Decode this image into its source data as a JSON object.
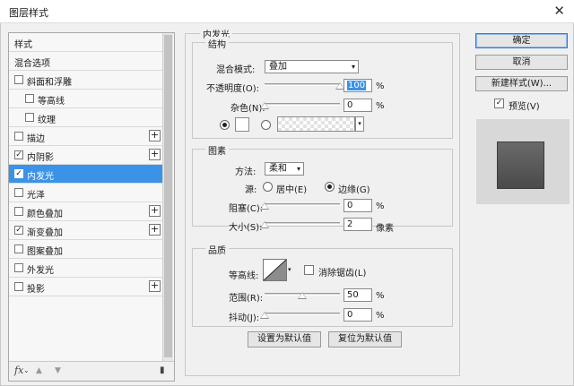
{
  "window": {
    "title": "图层样式"
  },
  "style_list": {
    "header": "样式",
    "items": [
      {
        "label": "混合选项",
        "has_checkbox": false,
        "checked": false,
        "has_plus": false,
        "indent": 0,
        "selected": false
      },
      {
        "label": "斜面和浮雕",
        "has_checkbox": true,
        "checked": false,
        "has_plus": false,
        "indent": 0,
        "selected": false
      },
      {
        "label": "等高线",
        "has_checkbox": true,
        "checked": false,
        "has_plus": false,
        "indent": 1,
        "selected": false
      },
      {
        "label": "纹理",
        "has_checkbox": true,
        "checked": false,
        "has_plus": false,
        "indent": 1,
        "selected": false
      },
      {
        "label": "描边",
        "has_checkbox": true,
        "checked": false,
        "has_plus": true,
        "indent": 0,
        "selected": false
      },
      {
        "label": "内阴影",
        "has_checkbox": true,
        "checked": true,
        "has_plus": true,
        "indent": 0,
        "selected": false
      },
      {
        "label": "内发光",
        "has_checkbox": true,
        "checked": true,
        "has_plus": false,
        "indent": 0,
        "selected": true
      },
      {
        "label": "光泽",
        "has_checkbox": true,
        "checked": false,
        "has_plus": false,
        "indent": 0,
        "selected": false
      },
      {
        "label": "颜色叠加",
        "has_checkbox": true,
        "checked": false,
        "has_plus": true,
        "indent": 0,
        "selected": false
      },
      {
        "label": "渐变叠加",
        "has_checkbox": true,
        "checked": true,
        "has_plus": true,
        "indent": 0,
        "selected": false
      },
      {
        "label": "图案叠加",
        "has_checkbox": true,
        "checked": false,
        "has_plus": false,
        "indent": 0,
        "selected": false
      },
      {
        "label": "外发光",
        "has_checkbox": true,
        "checked": false,
        "has_plus": false,
        "indent": 0,
        "selected": false
      },
      {
        "label": "投影",
        "has_checkbox": true,
        "checked": false,
        "has_plus": true,
        "indent": 0,
        "selected": false
      }
    ],
    "footer_icons": [
      "fx-icon",
      "arrow-up-icon",
      "arrow-down-icon",
      "trash-icon"
    ],
    "footer_fx": "fx",
    "footer_fx_caret": "⌄"
  },
  "panel": {
    "title": "内发光",
    "structure": {
      "title": "结构",
      "blend_mode_label": "混合模式:",
      "blend_mode_value": "叠加",
      "opacity_label": "不透明度(O):",
      "opacity_value": "100",
      "opacity_unit": "%",
      "opacity_fraction": 1.0,
      "noise_label": "杂色(N):",
      "noise_value": "0",
      "noise_unit": "%",
      "noise_fraction": 0.0,
      "color_selected": true
    },
    "elements": {
      "title": "图素",
      "method_label": "方法:",
      "method_value": "柔和",
      "source_label": "源:",
      "source_center": "居中(E)",
      "source_edge": "边缘(G)",
      "source_edge_selected": true,
      "choke_label": "阻塞(C):",
      "choke_value": "0",
      "choke_unit": "%",
      "choke_fraction": 0.0,
      "size_label": "大小(S):",
      "size_value": "2",
      "size_unit": "像素",
      "size_fraction": 0.0
    },
    "quality": {
      "title": "品质",
      "contour_label": "等高线:",
      "antialias_label": "消除锯齿(L)",
      "antialias_checked": false,
      "range_label": "范围(R):",
      "range_value": "50",
      "range_unit": "%",
      "range_fraction": 0.5,
      "jitter_label": "抖动(J):",
      "jitter_value": "0",
      "jitter_unit": "%",
      "jitter_fraction": 0.0
    },
    "make_default": "设置为默认值",
    "reset_default": "复位为默认值"
  },
  "buttons": {
    "ok": "确定",
    "cancel": "取消",
    "new_style": "新建样式(W)...",
    "preview_label": "预览(V)",
    "preview_checked": true
  },
  "icons": {
    "close": "close-icon",
    "dropdown": "chevron-down-icon",
    "check": "checkmark-icon",
    "plus": "plus-icon"
  },
  "glyphs": {
    "close": "✕",
    "dropdown": "▾",
    "check": "✓",
    "plus": "+",
    "up": "▲",
    "down": "▼",
    "trash": "▮"
  },
  "colors": {
    "accent": "#3b93e8",
    "glow_color": "#ffffff"
  }
}
